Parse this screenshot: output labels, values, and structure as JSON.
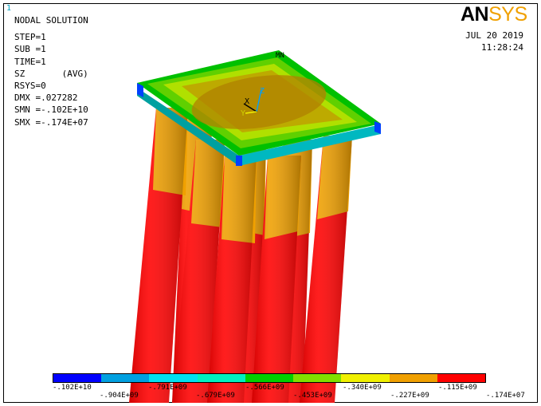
{
  "window_number": "1",
  "info": {
    "title": "NODAL SOLUTION",
    "step": "STEP=1",
    "sub": "SUB =1",
    "time": "TIME=1",
    "result": "SZ       (AVG)",
    "rsys": "RSYS=0",
    "dmx": "DMX =.027282",
    "smn": "SMN =-.102E+10",
    "smx": "SMX =-.174E+07"
  },
  "logo": {
    "an": "AN",
    "sys": "SYS"
  },
  "date": "JUL 20 2019",
  "time": "11:28:24",
  "markers": {
    "mn": "MN",
    "axis_x": "X",
    "axis_y": "Y",
    "axis_z": "Z"
  },
  "legend": {
    "colors": [
      "#0000ff",
      "#00a0e0",
      "#00e0f0",
      "#00f0c0",
      "#00d000",
      "#80e000",
      "#f0f000",
      "#f0a000",
      "#ff0000"
    ],
    "top_labels": [
      "-.102E+10",
      "-.791E+09",
      "-.566E+09",
      "-.340E+09",
      "-.115E+09"
    ],
    "bottom_labels": [
      "-.904E+09",
      "-.679E+09",
      "-.453E+09",
      "-.227E+09",
      "-.174E+07"
    ]
  }
}
